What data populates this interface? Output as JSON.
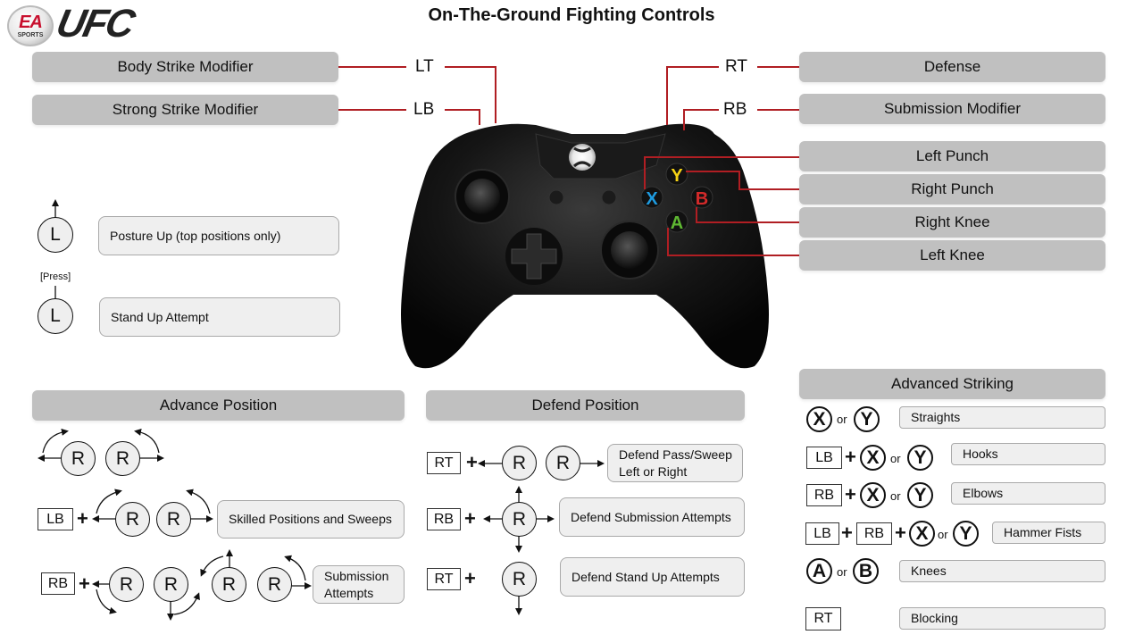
{
  "header": {
    "logo_ea": "EA",
    "logo_sports": "SPORTS",
    "logo_game": "UFC",
    "title": "On-The-Ground Fighting Controls"
  },
  "colors": {
    "callout_line": "#b01e23",
    "label_box": "#c0c0c0",
    "desc_box": "#efefef",
    "x_button": "#1e9be0",
    "y_button": "#f5d215",
    "b_button": "#d42a2a",
    "a_button": "#5fb832"
  },
  "controller_map": {
    "LT": {
      "button": "LT",
      "action": "Body Strike Modifier"
    },
    "LB": {
      "button": "LB",
      "action": "Strong Strike Modifier"
    },
    "RT": {
      "button": "RT",
      "action": "Defense"
    },
    "RB": {
      "button": "RB",
      "action": "Submission Modifier"
    },
    "X": {
      "button": "X",
      "action": "Left Punch"
    },
    "Y": {
      "button": "Y",
      "action": "Right Punch"
    },
    "B": {
      "button": "B",
      "action": "Right Knee"
    },
    "A": {
      "button": "A",
      "action": "Left Knee"
    }
  },
  "left_stick": {
    "posture": {
      "stick": "L",
      "action": "Posture Up (top positions only)"
    },
    "stand": {
      "stick": "L",
      "press_label": "[Press]",
      "action": "Stand Up Attempt"
    }
  },
  "advance_position": {
    "title": "Advance Position",
    "rows": [
      {
        "modifier": "",
        "stick": "R",
        "action": ""
      },
      {
        "modifier": "LB",
        "plus": "+",
        "stick": "R",
        "action": "Skilled Positions and Sweeps"
      },
      {
        "modifier": "RB",
        "plus": "+",
        "stick": "R",
        "action": "Submission Attempts"
      }
    ]
  },
  "defend_position": {
    "title": "Defend Position",
    "rows": [
      {
        "modifier": "RT",
        "plus": "+",
        "stick": "R",
        "action": "Defend Pass/Sweep Left or Right"
      },
      {
        "modifier": "RB",
        "plus": "+",
        "stick": "R",
        "action": "Defend Submission Attempts"
      },
      {
        "modifier": "RT",
        "plus": "+",
        "stick": "R",
        "action": "Defend Stand Up Attempts"
      }
    ]
  },
  "advanced_striking": {
    "title": "Advanced Striking",
    "or": "or",
    "plus": "+",
    "rows": [
      {
        "keys": [],
        "buttons": [
          "X",
          "Y"
        ],
        "action": "Straights"
      },
      {
        "keys": [
          "LB"
        ],
        "buttons": [
          "X",
          "Y"
        ],
        "action": "Hooks"
      },
      {
        "keys": [
          "RB"
        ],
        "buttons": [
          "X",
          "Y"
        ],
        "action": "Elbows"
      },
      {
        "keys": [
          "LB",
          "RB"
        ],
        "buttons": [
          "X",
          "Y"
        ],
        "action": "Hammer Fists"
      },
      {
        "keys": [],
        "buttons": [
          "A",
          "B"
        ],
        "action": "Knees"
      },
      {
        "keys": [
          "RT"
        ],
        "buttons": [],
        "action": "Blocking"
      }
    ]
  }
}
